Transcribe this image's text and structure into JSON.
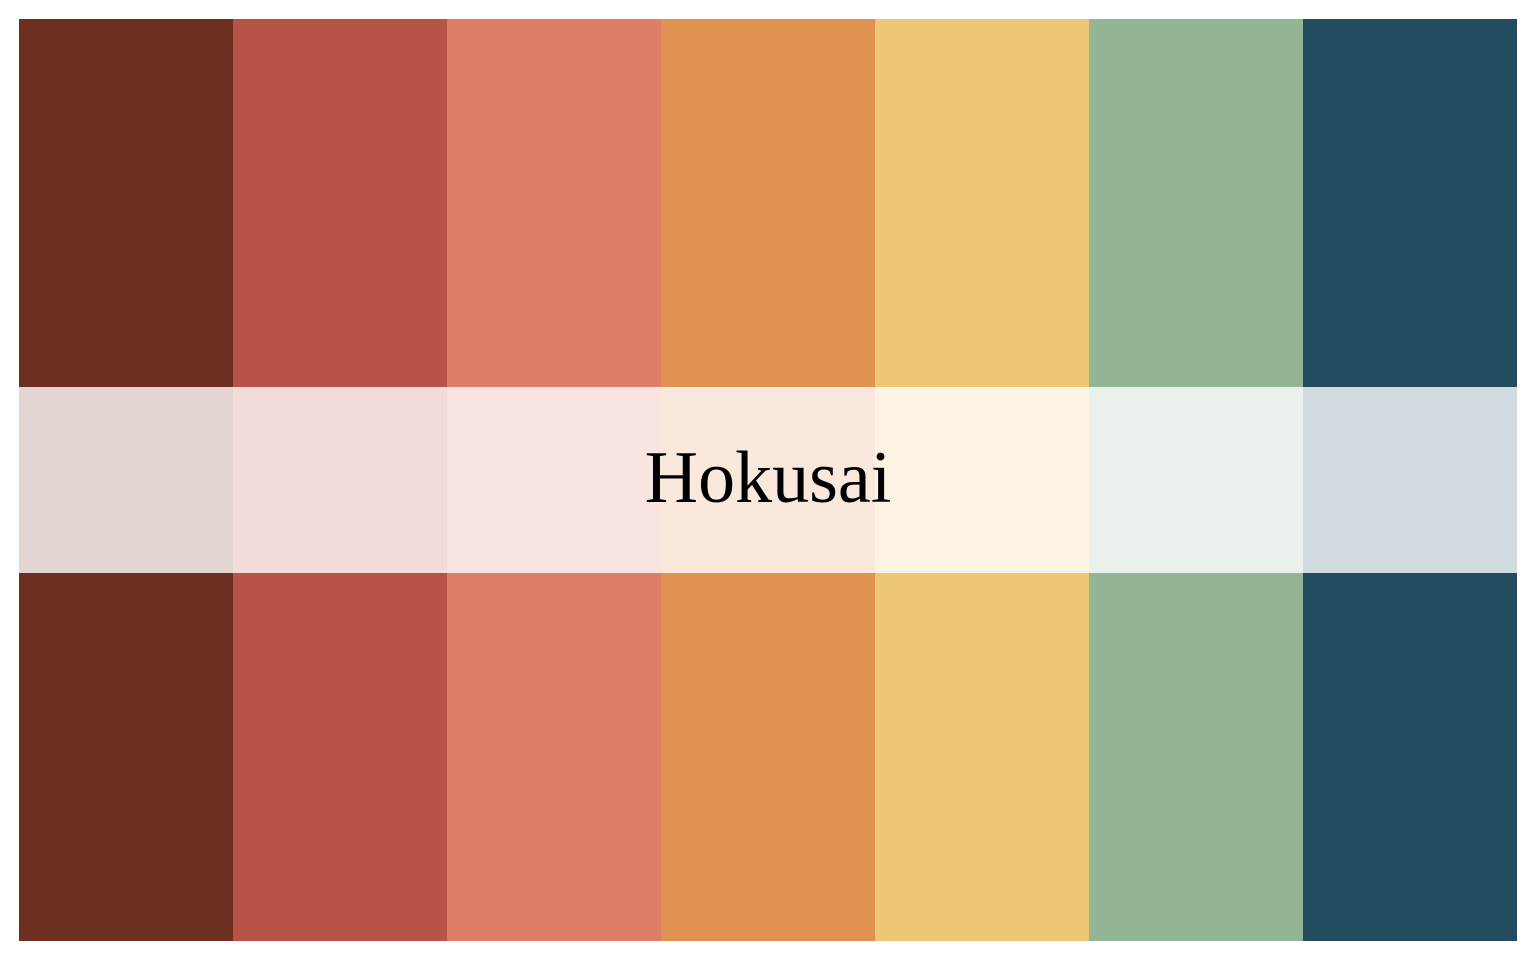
{
  "palette": {
    "name": "Hokusai",
    "colors": [
      "#6d2f20",
      "#b75347",
      "#df7e66",
      "#e09351",
      "#edc775",
      "#94b594",
      "#224b5e"
    ]
  }
}
